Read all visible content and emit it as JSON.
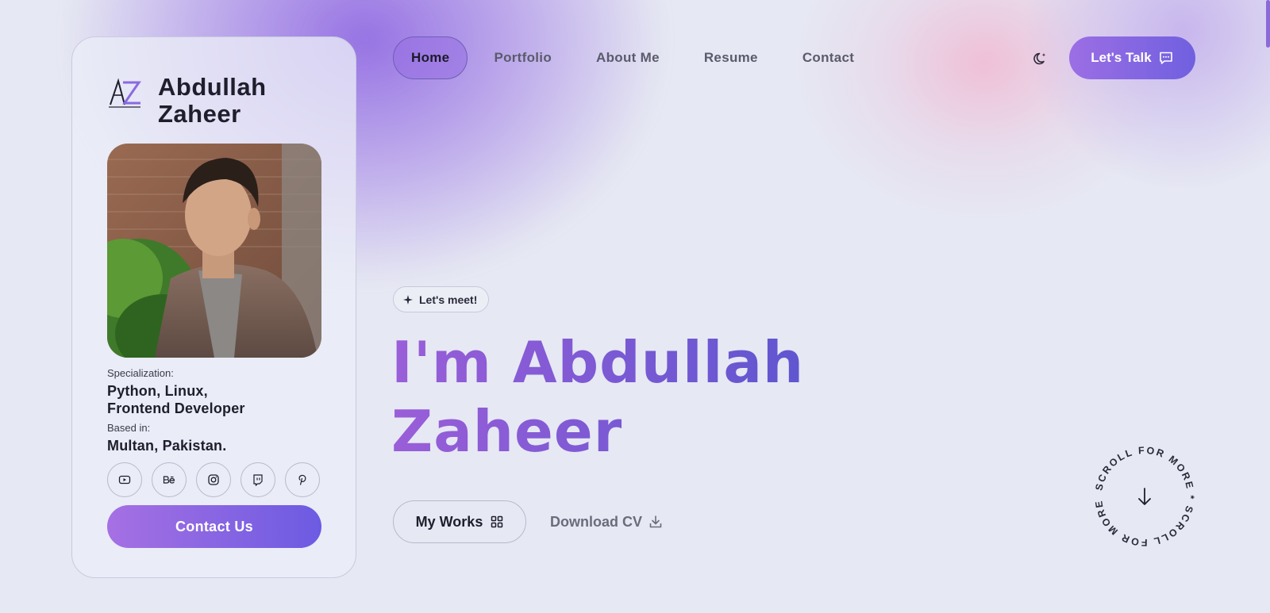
{
  "brand": {
    "name": "Abdullah Zaheer",
    "logo_text": "AZ"
  },
  "profile": {
    "photo_alt": "Abdullah Zaheer portrait",
    "specialization_label": "Specialization:",
    "specialization_value": "Python, Linux, Frontend Developer",
    "based_label": "Based in:",
    "based_value": "Multan, Pakistan.",
    "socials": [
      {
        "icon": "youtube-icon"
      },
      {
        "icon": "behance-icon"
      },
      {
        "icon": "instagram-icon"
      },
      {
        "icon": "twitch-icon"
      },
      {
        "icon": "pinterest-icon"
      }
    ],
    "contact_label": "Contact Us"
  },
  "nav": {
    "items": [
      {
        "label": "Home",
        "active": true
      },
      {
        "label": "Portfolio"
      },
      {
        "label": "About Me"
      },
      {
        "label": "Resume"
      },
      {
        "label": "Contact"
      }
    ],
    "talk_label": "Let's Talk"
  },
  "hero": {
    "badge": "Let's meet!",
    "headline_line1": "I'm Abdullah",
    "headline_line2": "Zaheer",
    "works_label": "My Works",
    "cv_label": "Download CV",
    "scroll_text": "SCROLL FOR MORE * SCROLL FOR MORE *"
  },
  "colors": {
    "accent_start": "#a670e3",
    "accent_end": "#6c5be2",
    "background": "#e6e8f3",
    "text": "#1e1e2c"
  }
}
